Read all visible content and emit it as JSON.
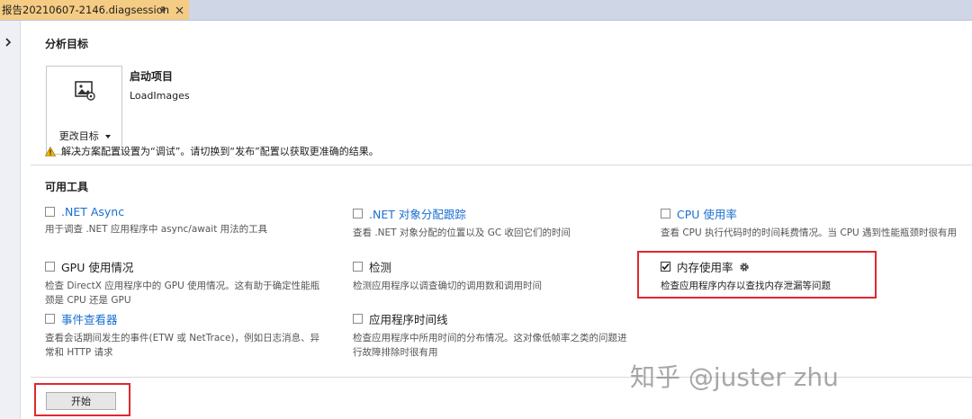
{
  "tab": {
    "title": "报告20210607-2146.diagsession"
  },
  "analysis_target": {
    "heading": "分析目标",
    "change_target_label": "更改目标",
    "startup_title": "启动项目",
    "startup_name": "LoadImages",
    "warning": "解决方案配置设置为“调试”。请切换到“发布”配置以获取更准确的结果。"
  },
  "tools": {
    "heading": "可用工具",
    "items": [
      {
        "name": ".NET Async",
        "desc": "用于调查 .NET 应用程序中 async/await 用法的工具",
        "checked": false,
        "link": true
      },
      {
        "name": ".NET 对象分配跟踪",
        "desc": "查看 .NET 对象分配的位置以及 GC 收回它们的时间",
        "checked": false,
        "link": true
      },
      {
        "name": "CPU 使用率",
        "desc": "查看 CPU 执行代码时的时间耗费情况。当 CPU 遇到性能瓶颈时很有用",
        "checked": false,
        "link": true
      },
      {
        "name": "GPU 使用情况",
        "desc": "检查 DirectX 应用程序中的 GPU 使用情况。这有助于确定性能瓶颈是 CPU 还是 GPU",
        "checked": false,
        "link": false
      },
      {
        "name": "检测",
        "desc": "检测应用程序以调查确切的调用数和调用时间",
        "checked": false,
        "link": false
      },
      {
        "name": "内存使用率",
        "desc": "检查应用程序内存以查找内存泄漏等问题",
        "checked": true,
        "link": false
      },
      {
        "name": "事件查看器",
        "desc": "查看会话期间发生的事件(ETW 或 NetTrace)，例如日志消息、异常和 HTTP 请求",
        "checked": false,
        "link": true
      },
      {
        "name": "应用程序时间线",
        "desc": "检查应用程序中所用时间的分布情况。这对像低帧率之类的问题进行故障排除时很有用",
        "checked": false,
        "link": false
      }
    ]
  },
  "start_button": "开始",
  "watermark": "知乎 @juster zhu",
  "colors": {
    "tab_active": "#f5cc84",
    "link": "#1a6fd1",
    "highlight": "#e0282e"
  }
}
